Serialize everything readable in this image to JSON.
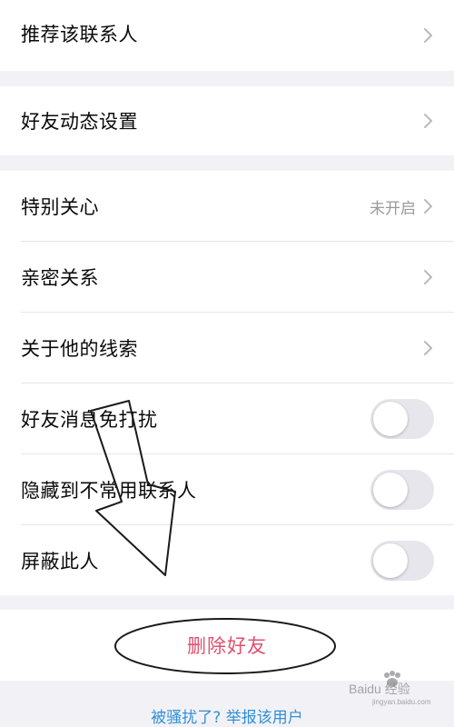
{
  "sections": {
    "recommend": {
      "label": "推荐该联系人"
    },
    "moments": {
      "label": "好友动态设置"
    },
    "special_care": {
      "label": "特别关心",
      "value": "未开启"
    },
    "intimacy": {
      "label": "亲密关系"
    },
    "clues": {
      "label": "关于他的线索"
    },
    "mute": {
      "label": "好友消息免打扰",
      "on": false
    },
    "hide": {
      "label": "隐藏到不常用联系人",
      "on": false
    },
    "block": {
      "label": "屏蔽此人",
      "on": false
    }
  },
  "delete_button": {
    "label": "删除好友"
  },
  "bottom_link": {
    "text": "被骚扰了? 举报该用户"
  },
  "watermark": {
    "text": "Baidu 经验",
    "subtext": "jingyan.baidu.com"
  },
  "icons": {
    "chevron": "chevron-right-icon"
  },
  "colors": {
    "background": "#f2f2f6",
    "delete": "#e0506e",
    "link": "#2f8fd8",
    "toggle_off": "#e6e6ec"
  }
}
